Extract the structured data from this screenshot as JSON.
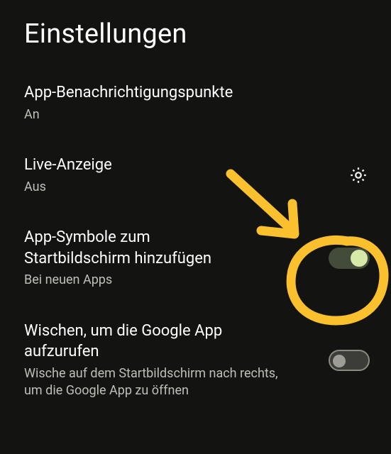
{
  "page": {
    "title": "Einstellungen"
  },
  "settings": [
    {
      "title": "App-Benachrichtigungspunkte",
      "subtitle": "An",
      "control": "none"
    },
    {
      "title": "Live-Anzeige",
      "subtitle": "Aus",
      "control": "gear"
    },
    {
      "title": "App-Symbole zum Startbildschirm hinzufügen",
      "subtitle": "Bei neuen Apps",
      "control": "toggle",
      "toggle_state": "on"
    },
    {
      "title": "Wischen, um die Google App aufzurufen",
      "subtitle": "Wische auf dem Startbildschirm nach rechts, um die Google App zu öffnen",
      "control": "toggle",
      "toggle_state": "off"
    }
  ],
  "colors": {
    "background": "#131312",
    "text_primary": "#fefefe",
    "text_secondary": "#bfbfb8",
    "toggle_on_track": "#434c3b",
    "toggle_on_knob": "#d7e9a8",
    "toggle_off_track": "#3c3c38",
    "toggle_off_knob": "#9d9d95",
    "annotation": "#fbc02d"
  }
}
